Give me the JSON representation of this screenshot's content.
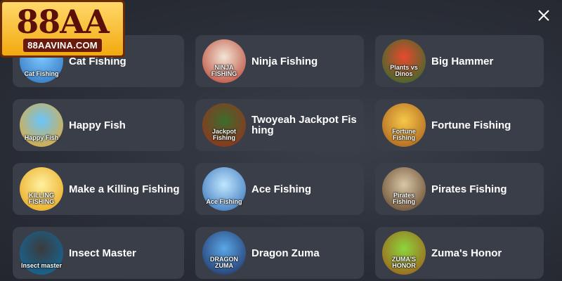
{
  "logo": {
    "main": "88AA",
    "sub": "88AAVINA.COM"
  },
  "games": [
    {
      "name": "Cat Fishing",
      "thumb_text": "Cat Fishing"
    },
    {
      "name": "Ninja Fishing",
      "thumb_text": "NINJA FISHING"
    },
    {
      "name": "Big Hammer",
      "thumb_text": "Plants vs Dinos"
    },
    {
      "name": "Happy Fish",
      "thumb_text": "Happy Fish"
    },
    {
      "name": "Twoyeah Jackpot Fishing",
      "thumb_text": "Jackpot Fishing"
    },
    {
      "name": "Fortune Fishing",
      "thumb_text": "Fortune Fishing"
    },
    {
      "name": "Make a Killing Fishing",
      "thumb_text": "KILLING FISHING"
    },
    {
      "name": "Ace Fishing",
      "thumb_text": "Ace Fishing"
    },
    {
      "name": "Pirates Fishing",
      "thumb_text": "Pirates Fishing"
    },
    {
      "name": "Insect Master",
      "thumb_text": "Insect master"
    },
    {
      "name": "Dragon Zuma",
      "thumb_text": "DRAGON ZUMA"
    },
    {
      "name": "Zuma's Honor",
      "thumb_text": "ZUMA'S HONOR"
    }
  ]
}
